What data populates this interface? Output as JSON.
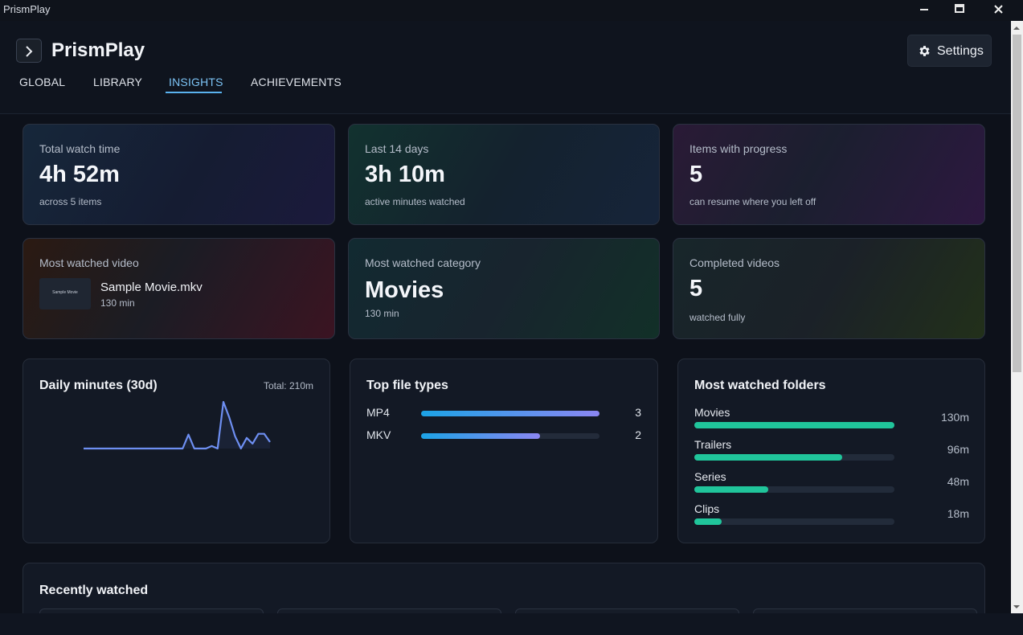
{
  "window": {
    "title": "PrismPlay"
  },
  "header": {
    "title": "PrismPlay",
    "settings_label": "Settings",
    "tabs": [
      {
        "label": "GLOBAL",
        "active": false
      },
      {
        "label": "LIBRARY",
        "active": false
      },
      {
        "label": "INSIGHTS",
        "active": true
      },
      {
        "label": "ACHIEVEMENTS",
        "active": false
      }
    ]
  },
  "stats": {
    "total_watch": {
      "label": "Total watch time",
      "value": "4h 52m",
      "sub": "across 5 items"
    },
    "last14": {
      "label": "Last 14 days",
      "value": "3h 10m",
      "sub": "active minutes watched"
    },
    "progress": {
      "label": "Items with progress",
      "value": "5",
      "sub": "can resume where you left off"
    },
    "most_video": {
      "label": "Most watched video",
      "thumb_text": "Sample Movie",
      "name": "Sample Movie.mkv",
      "minutes": "130 min"
    },
    "most_category": {
      "label": "Most watched category",
      "value": "Movies",
      "sub": "130 min"
    },
    "completed": {
      "label": "Completed videos",
      "value": "5",
      "sub": "watched fully"
    }
  },
  "daily": {
    "title": "Daily minutes (30d)",
    "total": "Total: 210m",
    "line_color": "#6e8ff2"
  },
  "chart_data": {
    "type": "line",
    "title": "Daily minutes (30d)",
    "x": [
      1,
      2,
      3,
      4,
      5,
      6,
      7,
      8,
      9,
      10,
      11,
      12,
      13,
      14,
      15,
      16,
      17,
      18,
      19,
      20,
      21,
      22,
      23,
      24,
      25,
      26,
      27,
      28,
      29,
      30
    ],
    "values": [
      0,
      0,
      0,
      0,
      0,
      0,
      0,
      0,
      0,
      0,
      0,
      0,
      0,
      0,
      0,
      0,
      17,
      0,
      0,
      0,
      0,
      0,
      3,
      0,
      0,
      0,
      0,
      57,
      38,
      15,
      0,
      13,
      6,
      18,
      18,
      8
    ],
    "series": [
      {
        "values": [
          0,
          0,
          0,
          0,
          0,
          0,
          0,
          0,
          0,
          0,
          0,
          0,
          0,
          0,
          0,
          0,
          0,
          0,
          17,
          0,
          0,
          0,
          3,
          0,
          57,
          38,
          15,
          0,
          13,
          6,
          18,
          18,
          8
        ]
      }
    ]
  },
  "file_types": {
    "title": "Top file types",
    "items": [
      {
        "label": "MP4",
        "count": "3",
        "value": 3
      },
      {
        "label": "MKV",
        "count": "2",
        "value": 2
      }
    ],
    "max": 3
  },
  "folders": {
    "title": "Most watched folders",
    "max": 130,
    "items": [
      {
        "label": "Movies",
        "minutes": "130m",
        "value": 130
      },
      {
        "label": "Trailers",
        "minutes": "96m",
        "value": 96
      },
      {
        "label": "Series",
        "minutes": "48m",
        "value": 48
      },
      {
        "label": "Clips",
        "minutes": "18m",
        "value": 18
      }
    ]
  },
  "recent": {
    "title": "Recently watched"
  }
}
